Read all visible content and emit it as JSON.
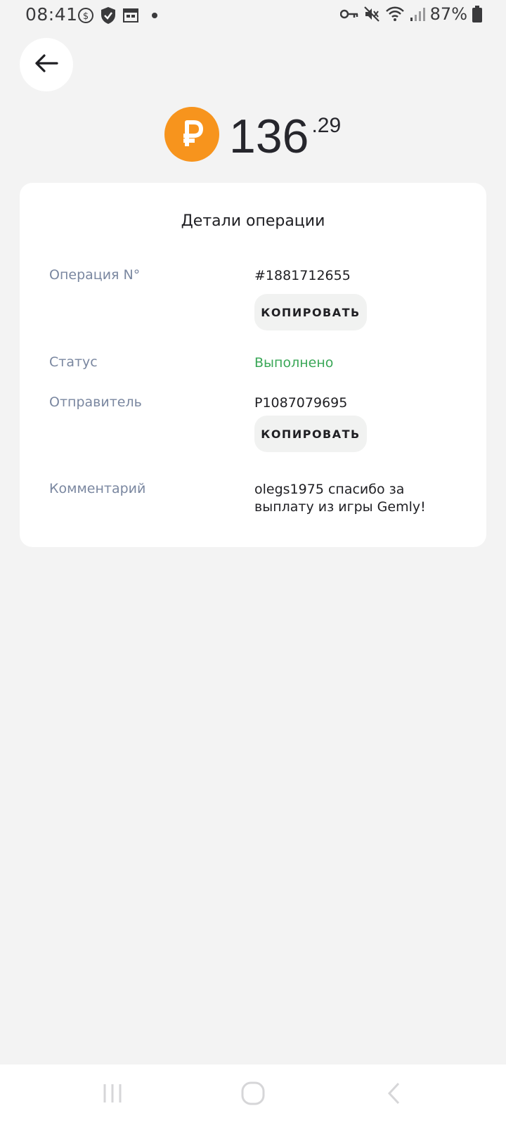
{
  "status_bar": {
    "time": "08:41",
    "battery": "87%",
    "left_icons": [
      "dollar-circle-icon",
      "shield-check-icon",
      "calendar-icon",
      "dot-icon"
    ],
    "right_icons": [
      "key-icon",
      "mute-icon",
      "wifi-icon",
      "signal-icon",
      "battery-icon"
    ]
  },
  "header": {
    "back_icon": "arrow-left-icon"
  },
  "amount": {
    "currency_icon": "ruble-coin-icon",
    "integer": "136",
    "decimal": ".29",
    "coin_color": "#f7941d"
  },
  "details": {
    "title": "Детали операции",
    "operation": {
      "label": "Операция N°",
      "value": "#1881712655",
      "copy_label": "КОПИРОВАТЬ"
    },
    "status": {
      "label": "Статус",
      "value": "Выполнено",
      "color": "#3aa757"
    },
    "sender": {
      "label": "Отправитель",
      "value": "P1087079695",
      "copy_label": "КОПИРОВАТЬ"
    },
    "comment": {
      "label": "Комментарий",
      "value": "olegs1975 спасибо за выплату из игры Gemly!"
    }
  },
  "nav_bar": {
    "recent_icon": "recent-apps-icon",
    "home_icon": "home-icon",
    "back_icon": "back-chevron-icon"
  }
}
